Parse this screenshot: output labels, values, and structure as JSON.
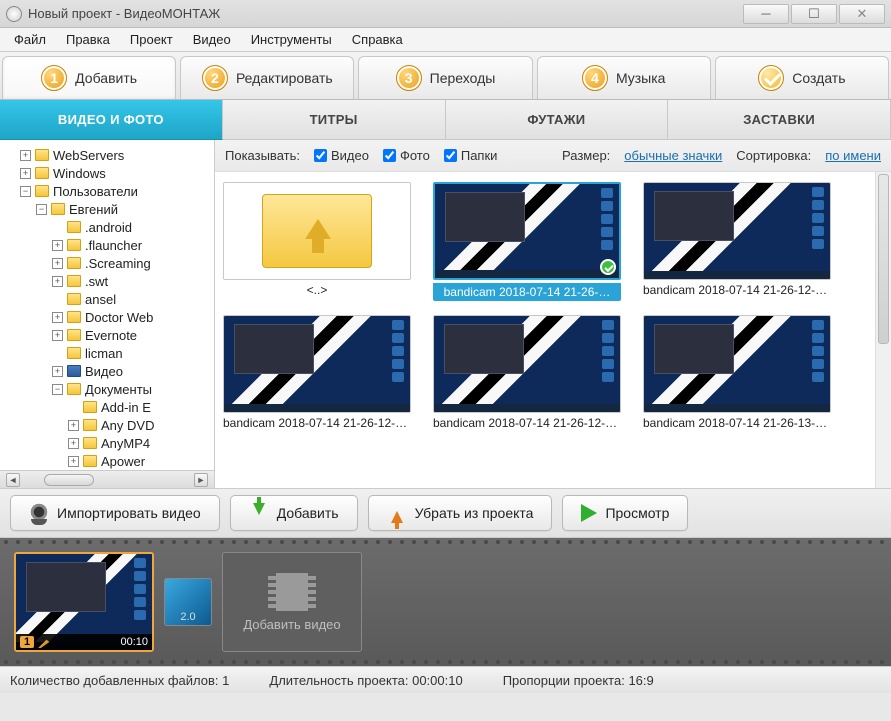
{
  "window": {
    "title": "Новый проект - ВидеоМОНТАЖ"
  },
  "menu": {
    "file": "Файл",
    "edit": "Правка",
    "project": "Проект",
    "video": "Видео",
    "tools": "Инструменты",
    "help": "Справка"
  },
  "steps": {
    "s1": "Добавить",
    "s2": "Редактировать",
    "s3": "Переходы",
    "s4": "Музыка",
    "s5": "Создать"
  },
  "subtabs": {
    "videophoto": "ВИДЕО И ФОТО",
    "titles": "ТИТРЫ",
    "footage": "ФУТАЖИ",
    "splash": "ЗАСТАВКИ"
  },
  "tree": [
    {
      "indent": 1,
      "toggle": "+",
      "label": "WebServers"
    },
    {
      "indent": 1,
      "toggle": "+",
      "label": "Windows"
    },
    {
      "indent": 1,
      "toggle": "−",
      "label": "Пользователи"
    },
    {
      "indent": 2,
      "toggle": "−",
      "label": "Евгений"
    },
    {
      "indent": 3,
      "toggle": "",
      "label": ".android"
    },
    {
      "indent": 3,
      "toggle": "+",
      "label": ".flauncher"
    },
    {
      "indent": 3,
      "toggle": "+",
      "label": ".Screaming"
    },
    {
      "indent": 3,
      "toggle": "+",
      "label": ".swt"
    },
    {
      "indent": 3,
      "toggle": "",
      "label": "ansel"
    },
    {
      "indent": 3,
      "toggle": "+",
      "label": "Doctor Web"
    },
    {
      "indent": 3,
      "toggle": "+",
      "label": "Evernote"
    },
    {
      "indent": 3,
      "toggle": "",
      "label": "licman"
    },
    {
      "indent": 3,
      "toggle": "+",
      "label": "Видео",
      "video": true
    },
    {
      "indent": 3,
      "toggle": "−",
      "label": "Документы"
    },
    {
      "indent": 4,
      "toggle": "",
      "label": "Add-in E"
    },
    {
      "indent": 4,
      "toggle": "+",
      "label": "Any DVD"
    },
    {
      "indent": 4,
      "toggle": "+",
      "label": "AnyMP4"
    },
    {
      "indent": 4,
      "toggle": "+",
      "label": "Apower"
    }
  ],
  "browser_toolbar": {
    "show_label": "Показывать:",
    "chk_video": "Видео",
    "chk_photo": "Фото",
    "chk_folders": "Папки",
    "size_label": "Размер:",
    "size_link": "обычные значки",
    "sort_label": "Сортировка:",
    "sort_link": "по имени"
  },
  "thumbs": {
    "up_folder": "<..>",
    "t1": "bandicam 2018-07-14 21-26-…",
    "t2": "bandicam 2018-07-14 21-26-12-53…",
    "t3": "bandicam 2018-07-14 21-26-12-85…",
    "t4": "bandicam 2018-07-14 21-26-12-96…",
    "t5": "bandicam 2018-07-14 21-26-13-18…"
  },
  "actions": {
    "import": "Импортировать видео",
    "add": "Добавить",
    "remove": "Убрать из проекта",
    "preview": "Просмотр"
  },
  "timeline": {
    "clip_index": "1",
    "clip_duration": "00:10",
    "transition": "2.0",
    "add_label": "Добавить видео"
  },
  "status": {
    "files_label": "Количество добавленных файлов:",
    "files_value": "1",
    "duration_label": "Длительность проекта:",
    "duration_value": "00:00:10",
    "aspect_label": "Пропорции проекта:",
    "aspect_value": "16:9"
  }
}
